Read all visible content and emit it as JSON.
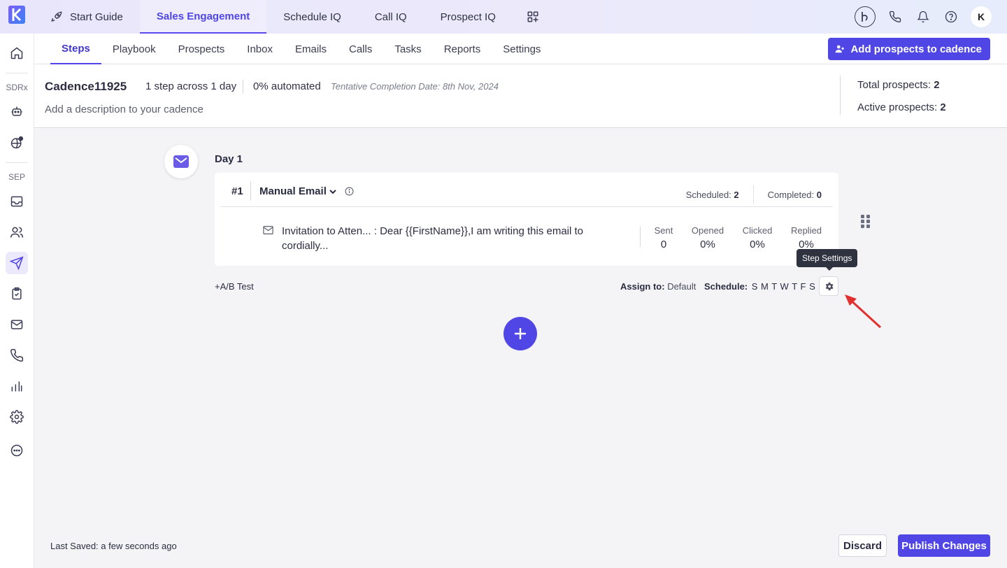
{
  "topnav": {
    "items": [
      {
        "label": "Start Guide",
        "icon": "rocket-icon"
      },
      {
        "label": "Sales Engagement",
        "active": true
      },
      {
        "label": "Schedule IQ"
      },
      {
        "label": "Call IQ"
      },
      {
        "label": "Prospect IQ"
      }
    ],
    "avatar_letter": "K"
  },
  "sidebar": {
    "sdrx_label": "SDRx",
    "sep_label": "SEP"
  },
  "subnav": {
    "tabs": [
      "Steps",
      "Playbook",
      "Prospects",
      "Inbox",
      "Emails",
      "Calls",
      "Tasks",
      "Reports",
      "Settings"
    ],
    "active_tab": "Steps",
    "add_button": "Add prospects to cadence"
  },
  "cadence": {
    "name": "Cadence11925",
    "steps_summary": "1 step across 1 day",
    "automated": "0% automated",
    "completion_date": "Tentative Completion Date: 8th Nov, 2024",
    "description": "Add a description to your cadence",
    "total_prospects_label": "Total prospects:",
    "total_prospects": "2",
    "active_prospects_label": "Active prospects:",
    "active_prospects": "2"
  },
  "day": {
    "label": "Day 1",
    "step": {
      "number": "#1",
      "type": "Manual Email",
      "scheduled_label": "Scheduled:",
      "scheduled": "2",
      "completed_label": "Completed:",
      "completed": "0",
      "text": "Invitation to Atten... : Dear {{FirstName}},I am writing this email to cordially...",
      "stats": {
        "sent_label": "Sent",
        "sent": "0",
        "opened_label": "Opened",
        "opened": "0%",
        "clicked_label": "Clicked",
        "clicked": "0%",
        "replied_label": "Replied",
        "replied": "0%"
      }
    },
    "ab_test": "+A/B Test",
    "assign_label": "Assign to:",
    "assign_value": "Default",
    "schedule_label": "Schedule:",
    "schedule_days": "S M T W T F S",
    "tooltip": "Step Settings"
  },
  "footer": {
    "last_saved": "Last Saved: a few seconds ago",
    "discard": "Discard",
    "publish": "Publish Changes"
  },
  "colors": {
    "accent": "#4f46e5",
    "annotation_arrow": "#e0312f"
  }
}
